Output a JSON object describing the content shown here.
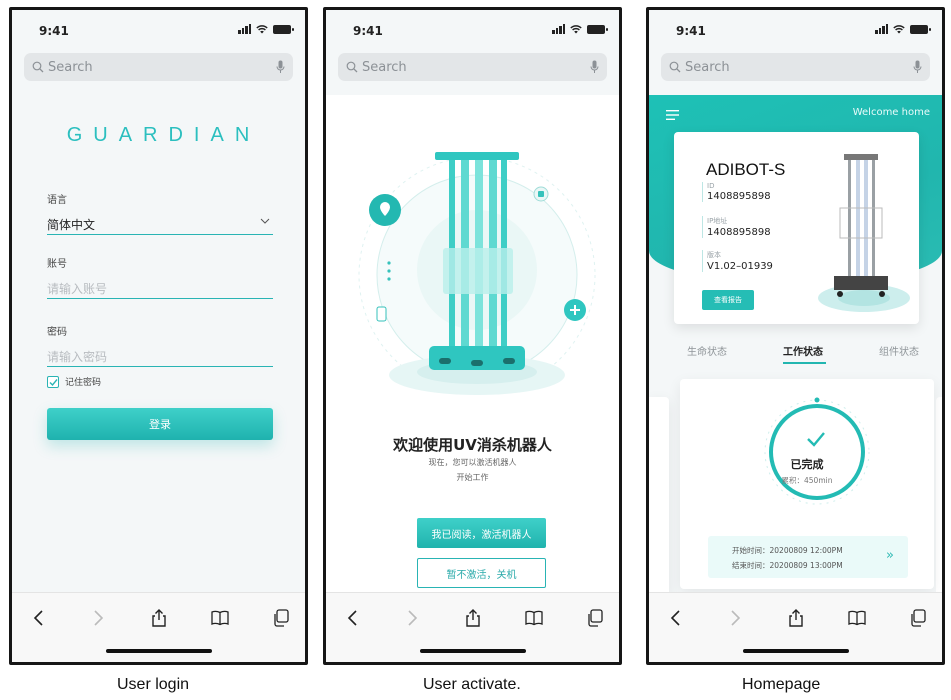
{
  "status": {
    "time": "9:41"
  },
  "search": {
    "placeholder": "Search"
  },
  "login": {
    "brand": "GUARDIAN",
    "language_label": "语言",
    "language_value": "简体中文",
    "account_label": "账号",
    "account_placeholder": "请输入账号",
    "password_label": "密码",
    "password_placeholder": "请输入密码",
    "remember_label": "记住密码",
    "login_button": "登录"
  },
  "activate": {
    "title": "欢迎使用UV消杀机器人",
    "subtitle1": "现在，您可以激活机器人",
    "subtitle2": "开始工作",
    "accept_button": "我已阅读，激活机器人",
    "decline_button": "暂不激活，关机"
  },
  "home": {
    "welcome": "Welcome home",
    "device_name": "ADIBOT-S",
    "id_label": "ID",
    "id_value": "1408895898",
    "ip_label": "IP地址",
    "ip_value": "1408895898",
    "version_label": "版本",
    "version_value": "V1.02–01939",
    "report_button": "查看报告",
    "tabs": [
      "生命状态",
      "工作状态",
      "组件状态"
    ],
    "status_text": "已完成",
    "accum_text": "累积：450min",
    "start_time": "开始时间：20200809 12:00PM",
    "end_time": "结束时间：20200809 13:00PM",
    "more_glyph": "»"
  },
  "captions": [
    "User login",
    "User activate.",
    "Homepage"
  ],
  "colors": {
    "accent": "#22b6b0",
    "accent_light": "#3fd0c9",
    "text_dark": "#222222"
  }
}
